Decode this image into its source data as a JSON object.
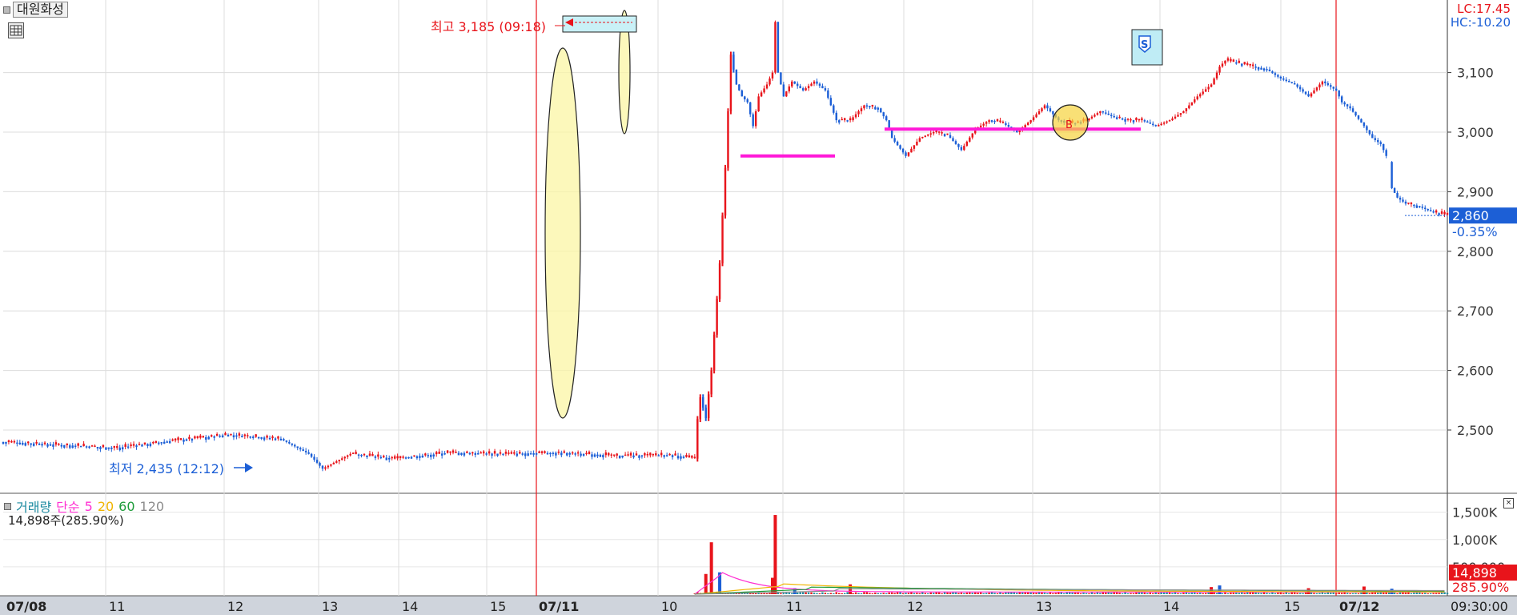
{
  "stock_name": "대원화성",
  "limit_info": {
    "lc": "LC:17.45",
    "hc": "HC:-10.20"
  },
  "current": {
    "price": "2,860",
    "change": "-0.35%"
  },
  "annotations": {
    "high": "최고 3,185 (09:18)",
    "low": "최저 2,435 (12:12)",
    "signal_s": "S",
    "signal_b": "B"
  },
  "volume_panel": {
    "title": "거래량",
    "ma_label": "단순",
    "ma_periods": [
      "5",
      "20",
      "60",
      "120"
    ],
    "current": "14,898주(285.90%)",
    "badge_value": "14,898",
    "badge_pct": "285.90%",
    "close_glyph": "×"
  },
  "colors": {
    "up": "#e8141b",
    "down": "#1c5fd6",
    "ma5": "#ff2fd2",
    "ma20": "#f0b400",
    "ma60": "#1e9c3a",
    "ma120": "#8c8c8c",
    "support": "#ff19d8",
    "highlight": "#fbf6a4"
  },
  "time_display": "09:30:00",
  "chart_data": [
    {
      "type": "candlestick",
      "price_axis": [
        "3,100",
        "3,000",
        "2,900",
        "2,800",
        "2,700",
        "2,600",
        "2,500"
      ],
      "ylim": [
        2395,
        3215
      ],
      "x_labels": [
        "07/08",
        "11",
        "12",
        "13",
        "14",
        "15",
        "07/11",
        "10",
        "11",
        "12",
        "13",
        "14",
        "15",
        "07/12"
      ],
      "sessions": [
        "07/08",
        "07/11",
        "07/12"
      ],
      "key_values": {
        "open_gap": 2500,
        "high": 3185,
        "low": 2435,
        "close": 2860,
        "support_1": 2960,
        "support_2": 3005
      },
      "path": [
        [
          0,
          2480
        ],
        [
          20,
          2475
        ],
        [
          40,
          2470
        ],
        [
          60,
          2482
        ],
        [
          80,
          2492
        ],
        [
          100,
          2485
        ],
        [
          110,
          2460
        ],
        [
          115,
          2435
        ],
        [
          125,
          2460
        ],
        [
          140,
          2452
        ],
        [
          160,
          2462
        ],
        [
          180,
          2460
        ],
        [
          200,
          2462
        ],
        [
          220,
          2457
        ],
        [
          240,
          2458
        ],
        [
          249,
          2452
        ],
        [
          249.5,
          2500
        ],
        [
          251,
          2555
        ],
        [
          253,
          2520
        ],
        [
          255,
          2600
        ],
        [
          258,
          2780
        ],
        [
          260,
          2940
        ],
        [
          262,
          3130
        ],
        [
          264,
          3080
        ],
        [
          266,
          3060
        ],
        [
          268,
          3050
        ],
        [
          270,
          3010
        ],
        [
          272,
          3060
        ],
        [
          275,
          3080
        ],
        [
          277,
          3100
        ],
        [
          278,
          3185
        ],
        [
          279,
          3100
        ],
        [
          281,
          3060
        ],
        [
          284,
          3085
        ],
        [
          288,
          3070
        ],
        [
          292,
          3085
        ],
        [
          296,
          3070
        ],
        [
          300,
          3020
        ],
        [
          305,
          3020
        ],
        [
          310,
          3045
        ],
        [
          315,
          3040
        ],
        [
          318,
          3020
        ],
        [
          320,
          2990
        ],
        [
          325,
          2960
        ],
        [
          330,
          2990
        ],
        [
          335,
          3000
        ],
        [
          340,
          2995
        ],
        [
          345,
          2970
        ],
        [
          350,
          3005
        ],
        [
          355,
          3020
        ],
        [
          360,
          3015
        ],
        [
          365,
          3000
        ],
        [
          370,
          3020
        ],
        [
          375,
          3045
        ],
        [
          380,
          3020
        ],
        [
          385,
          3015
        ],
        [
          390,
          3020
        ],
        [
          395,
          3035
        ],
        [
          400,
          3025
        ],
        [
          405,
          3020
        ],
        [
          410,
          3020
        ],
        [
          415,
          3010
        ],
        [
          420,
          3020
        ],
        [
          425,
          3035
        ],
        [
          430,
          3060
        ],
        [
          435,
          3080
        ],
        [
          438,
          3110
        ],
        [
          440,
          3120
        ],
        [
          445,
          3115
        ],
        [
          450,
          3110
        ],
        [
          455,
          3105
        ],
        [
          460,
          3090
        ],
        [
          465,
          3080
        ],
        [
          470,
          3060
        ],
        [
          475,
          3085
        ],
        [
          480,
          3070
        ],
        [
          482,
          3050
        ],
        [
          485,
          3040
        ],
        [
          490,
          3010
        ],
        [
          493,
          2990
        ],
        [
          496,
          2980
        ],
        [
          499,
          2950
        ],
        [
          499.5,
          2910
        ],
        [
          502,
          2890
        ],
        [
          505,
          2880
        ],
        [
          510,
          2875
        ],
        [
          515,
          2865
        ],
        [
          520,
          2860
        ]
      ]
    },
    {
      "type": "bar",
      "title": "거래량",
      "yaxis": [
        "1,500K",
        "1,000K",
        "500,000"
      ],
      "ylim": [
        0,
        1700000
      ],
      "spikes": [
        [
          253,
          370000
        ],
        [
          255,
          950000
        ],
        [
          258,
          400000
        ],
        [
          278,
          1450000
        ],
        [
          277,
          300000
        ],
        [
          285,
          110000
        ],
        [
          305,
          180000
        ],
        [
          435,
          130000
        ],
        [
          438,
          160000
        ],
        [
          470,
          110000
        ],
        [
          490,
          140000
        ],
        [
          500,
          100000
        ]
      ]
    }
  ]
}
